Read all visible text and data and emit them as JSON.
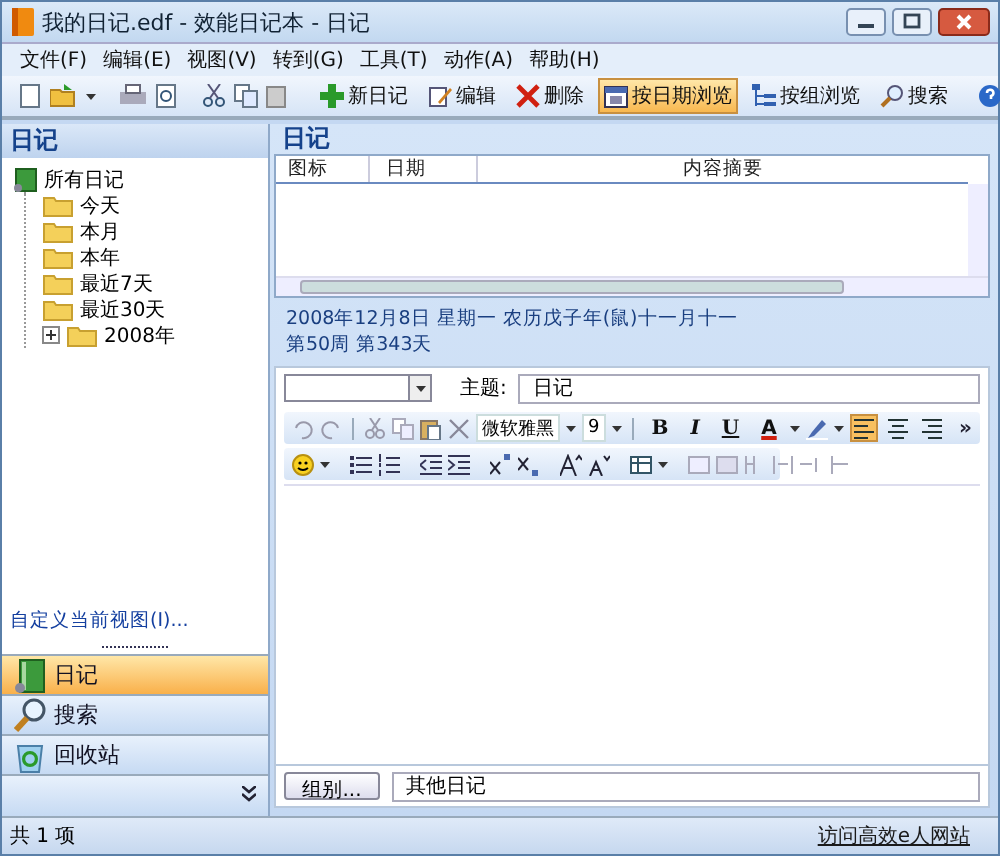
{
  "window": {
    "title": "我的日记.edf - 效能日记本 - 日记"
  },
  "menu": [
    {
      "label": "文件(F)"
    },
    {
      "label": "编辑(E)"
    },
    {
      "label": "视图(V)"
    },
    {
      "label": "转到(G)"
    },
    {
      "label": "工具(T)"
    },
    {
      "label": "动作(A)"
    },
    {
      "label": "帮助(H)"
    }
  ],
  "toolbar": [
    {
      "kind": "new",
      "label": "新日记",
      "selected": false
    },
    {
      "kind": "edit",
      "label": "编辑",
      "selected": false
    },
    {
      "kind": "delete",
      "label": "删除",
      "selected": false
    },
    {
      "kind": "by-date",
      "label": "按日期浏览",
      "selected": true
    },
    {
      "kind": "by-group",
      "label": "按组浏览",
      "selected": false
    },
    {
      "kind": "search",
      "label": "搜索",
      "selected": false
    }
  ],
  "sidebar": {
    "title": "日记",
    "tree": {
      "label": "所有日记",
      "children": [
        {
          "label": "今天"
        },
        {
          "label": "本月"
        },
        {
          "label": "本年"
        },
        {
          "label": "最近7天"
        },
        {
          "label": "最近30天"
        },
        {
          "label": "2008年",
          "expanded": false
        }
      ]
    },
    "custom_view_link": "自定义当前视图(I)...",
    "nav": [
      {
        "kind": "diary",
        "label": "日记",
        "selected": true
      },
      {
        "kind": "search",
        "label": "搜索",
        "selected": false
      },
      {
        "kind": "recycle",
        "label": "回收站",
        "selected": false
      }
    ]
  },
  "main": {
    "title": "日记",
    "columns": [
      "图标",
      "日期",
      "内容摘要"
    ],
    "date_line": "2008年12月8日 星期一 农历戊子年(鼠)十一月十一",
    "week_line": "第50周 第343天",
    "subject_label": "主题:",
    "subject_value": "日记",
    "font": "微软雅黑",
    "font_size": "9",
    "format_buttons": [
      {
        "kind": "bold",
        "label": "B"
      },
      {
        "kind": "italic",
        "label": "I"
      },
      {
        "kind": "underline",
        "label": "U"
      },
      {
        "kind": "color",
        "label": "A"
      }
    ],
    "alignment": [
      {
        "kind": "left",
        "selected": true
      },
      {
        "kind": "center",
        "selected": false
      },
      {
        "kind": "right",
        "selected": false
      }
    ],
    "more": "»",
    "group_button": "组别...",
    "group_value": "其他日记"
  },
  "status_bar": {
    "count": "共 1 项",
    "link": "访问高效e人网站"
  }
}
